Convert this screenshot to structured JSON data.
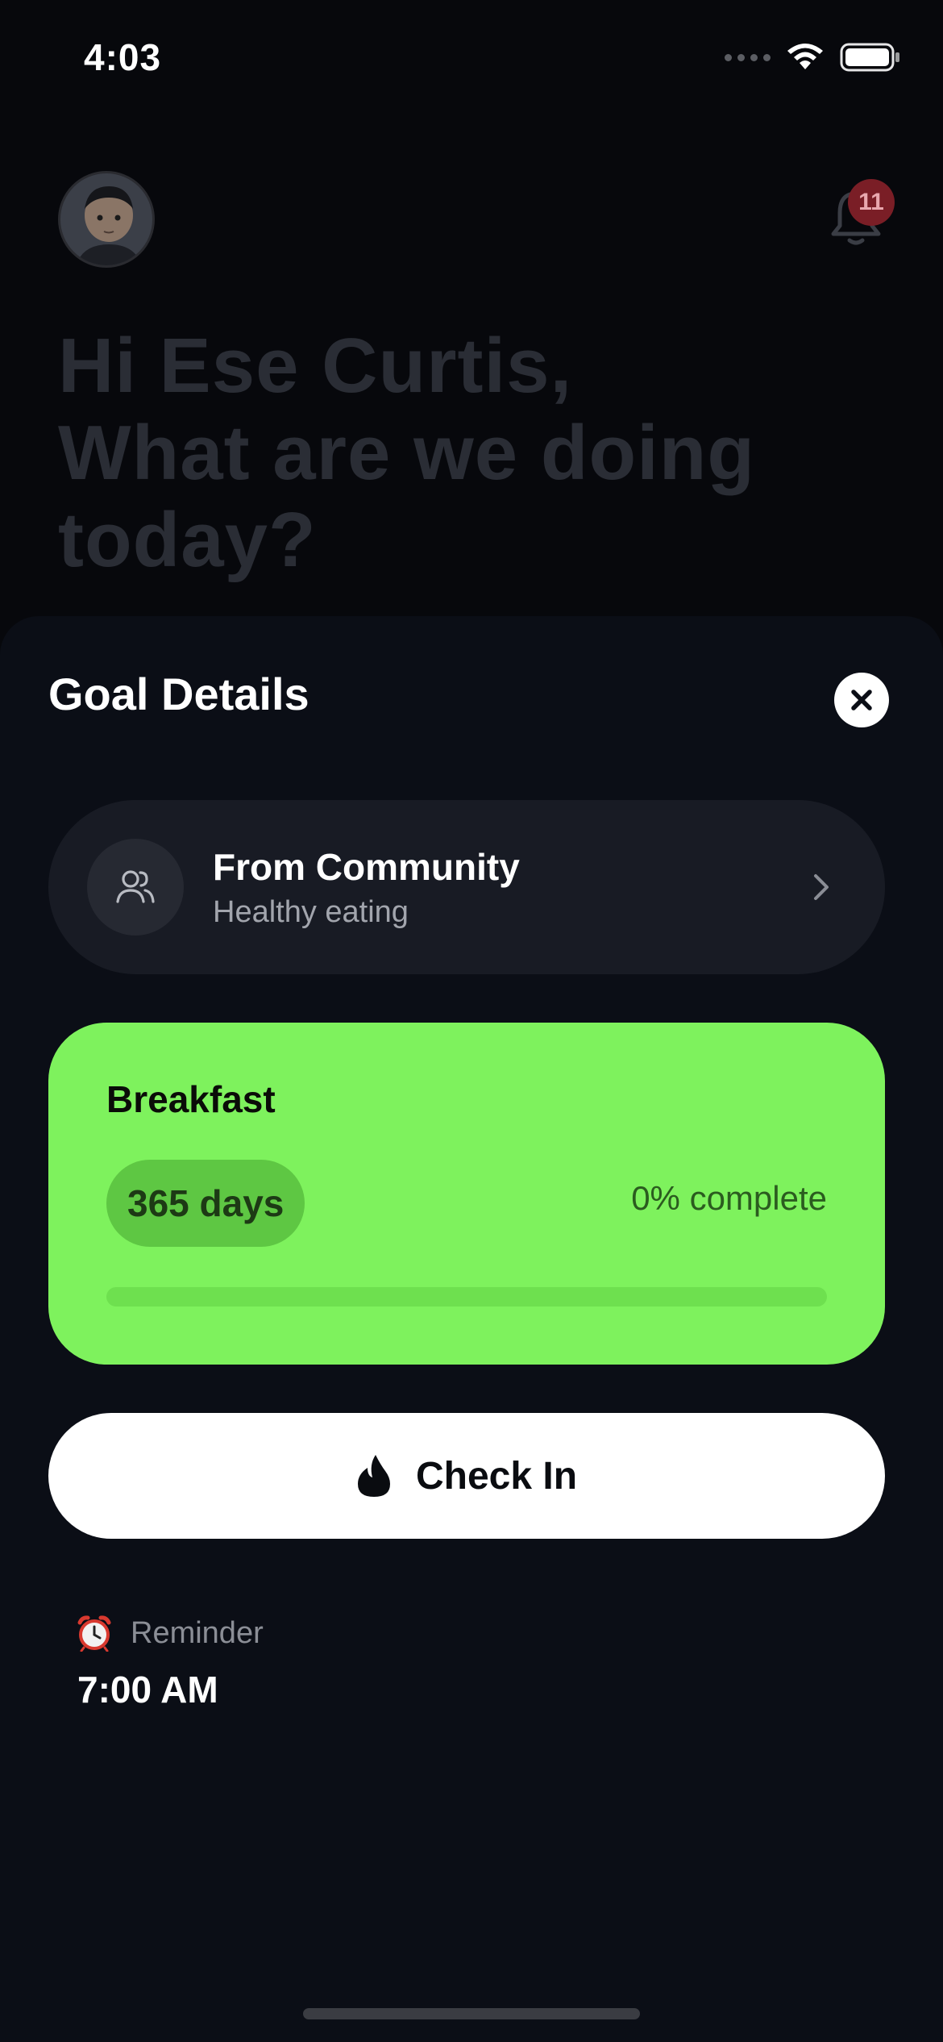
{
  "status_bar": {
    "time": "4:03"
  },
  "background": {
    "notification_count": "11",
    "greeting_line1": "Hi Ese Curtis,",
    "greeting_line2": "What are we doing",
    "greeting_line3": "today?"
  },
  "sheet": {
    "title": "Goal Details",
    "community": {
      "title": "From Community",
      "subtitle": "Healthy eating"
    },
    "goal": {
      "title": "Breakfast",
      "days": "365 days",
      "complete_text": "0% complete",
      "progress_fraction": 0
    },
    "checkin_label": "Check In",
    "reminder": {
      "label": "Reminder",
      "time": "7:00 AM"
    }
  },
  "colors": {
    "goal_card": "#7ef25d",
    "sheet_bg": "#0b0e16",
    "badge": "#7a1e26"
  },
  "icons": [
    "wifi-icon",
    "battery-icon",
    "bell-icon",
    "close-icon",
    "community-icon",
    "chevron-right-icon",
    "fire-icon",
    "alarm-clock-icon"
  ]
}
